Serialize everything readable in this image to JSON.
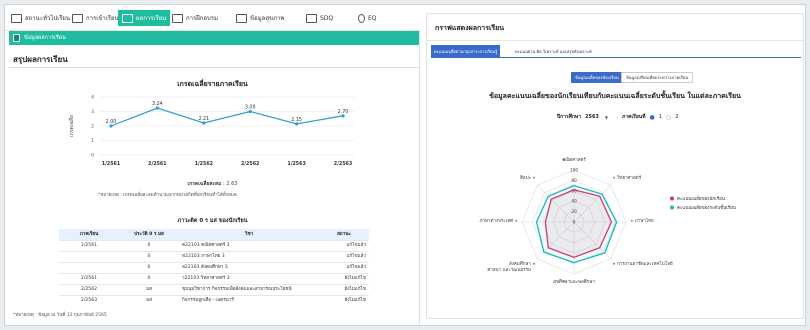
{
  "nav": {
    "items": [
      {
        "label": "สถานะทั่วไปเรียน"
      },
      {
        "label": "การเข้าเรียน"
      },
      {
        "label": "ผลการเรียน"
      },
      {
        "label": "การฝึกอบรม"
      },
      {
        "label": "ข้อมูลสุขภาพ"
      },
      {
        "label": "SDQ"
      },
      {
        "label": "EQ"
      }
    ]
  },
  "subbar": {
    "label": "ข้อมูลผลการเรียน"
  },
  "page_title": "สรุปผลการเรียน",
  "chart_data": {
    "type": "line",
    "title": "เกรดเฉลี่ยรายภาคเรียน",
    "ylabel": "เกรดเฉลี่ย",
    "categories": [
      "1/2561",
      "2/2561",
      "1/2562",
      "2/2562",
      "1/2563",
      "2/2563"
    ],
    "values": [
      2.0,
      3.24,
      2.21,
      3.0,
      2.15,
      2.7
    ],
    "value_labels": [
      "2.00",
      "3.24",
      "2.21",
      "3.00",
      "2.15",
      "2.70"
    ],
    "ylim": [
      0,
      4
    ],
    "yticks": [
      "0",
      "1",
      "2",
      "3",
      "4"
    ],
    "color": "#2b9fd3",
    "grid": true
  },
  "average": {
    "label": "เกรดเฉลี่ยสะสม",
    "value": "2.63"
  },
  "note1": "*หมายเหตุ : เกรดเฉลี่ยสะสมคำนวณจากหน่วยกิตที่นักเรียนทำได้ทั้งหมด",
  "grades_table": {
    "title": "ภาวะติด 0 ร มส ของนักเรียน",
    "headers": [
      "ภาคเรียน",
      "ประวัติ 0 ร มส",
      "วิชา",
      "สถานะ"
    ],
    "rows": [
      {
        "term": "1/2561",
        "grade": "0",
        "subject": "ค22103 คณิตศาสตร์ 3",
        "status": "แก้ไขแล้ว"
      },
      {
        "term": "",
        "grade": "0",
        "subject": "ท22103 ภาษาไทย 3",
        "status": "แก้ไขแล้ว"
      },
      {
        "term": "",
        "grade": "0",
        "subject": "ส22103 สังคมศึกษา 3",
        "status": "แก้ไขแล้ว"
      },
      {
        "term": "2/2561",
        "grade": "0",
        "subject": "ว22103 วิทยาศาสตร์ 3",
        "status": "ยังไม่แก้ไข"
      },
      {
        "term": "2/2562",
        "grade": "มส",
        "subject": "ชุมนุมวิชาการ กิจกรรมเพื่อสังคมและสาธารณประโยชน์",
        "status": "ยังไม่แก้ไข"
      },
      {
        "term": "2/2563",
        "grade": "มส",
        "subject": "กิจกรรมลูกเสือ - เนตรนารี",
        "status": "ยังไม่แก้ไข"
      }
    ]
  },
  "note2": "*หมายเหตุ : ข้อมูล ณ วันที่ 12 กุมภาพันธ์ 2565",
  "right": {
    "title": "กราฟแสดงผลการเรียน",
    "tabs": [
      "คะแนนเฉลี่ยตามกลุ่มสาระการเรียนรู้",
      "คะแนนผ่าน คิด วิเคราะห์ และสรุปสังเคราะห์"
    ],
    "buttons": [
      "ข้อมูลเฉลี่ยของห้องเรียน",
      "ข้อมูลเปรียบเทียบระหว่างภาคเรียน"
    ],
    "subtitle": "ข้อมูลคะแนนเฉลี่ยของนักเรียนเทียบกับคะแนนเฉลี่ยระดับชั้นเรียน ในแต่ละภาคเรียน",
    "year_label": "ปีการศึกษา",
    "year_value": "2563",
    "term_label": "ภาคเรียนที่",
    "term_options": [
      "1",
      "2"
    ]
  },
  "radar_data": {
    "type": "radar",
    "axes": [
      "คณิตศาสตร์",
      "วิทยาศาสตร์",
      "ภาษาไทย",
      "การงานอาชีพและเทคโนโลยี",
      "สุขศึกษาและพลศึกษา",
      "สังคมศึกษา ศาสนา และวัฒนธรรม",
      "ภาษาต่างประเทศ",
      "ศิลปะ"
    ],
    "ticks": [
      "0",
      "20",
      "40",
      "60",
      "80",
      "100"
    ],
    "max": 100,
    "series": [
      {
        "name": "คะแนนเฉลี่ยของนักเรียน",
        "color": "#e0306a",
        "values": [
          62,
          70,
          72,
          70,
          68,
          70,
          55,
          62
        ]
      },
      {
        "name": "คะแนนเฉลี่ยของระดับชั้นเรียน",
        "color": "#1bb6c1",
        "values": [
          70,
          76,
          82,
          84,
          78,
          82,
          72,
          70
        ]
      }
    ]
  }
}
